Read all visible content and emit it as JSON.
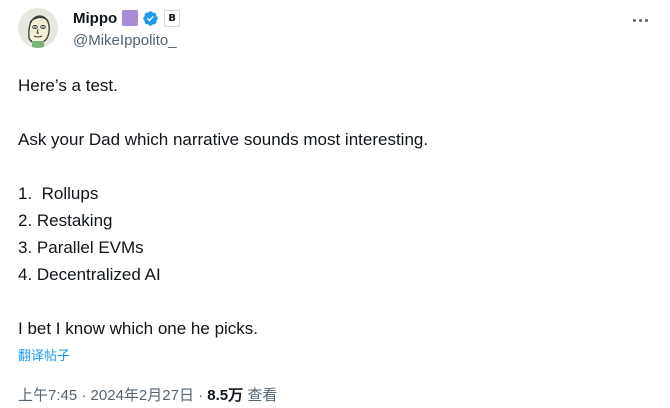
{
  "author": {
    "display_name": "Mippo",
    "handle": "@MikeIppolito_",
    "verified": true,
    "emoji_color": "#a88cd6",
    "verified_color": "#1d9bf0",
    "affiliate_badge_letter": "B"
  },
  "tweet": {
    "lines": [
      "Here’s a test.",
      "",
      "Ask your Dad which narrative sounds most interesting.",
      "",
      "1.  Rollups",
      "2. Restaking",
      "3. Parallel EVMs",
      "4. Decentralized AI",
      "",
      "I bet I know which one he picks."
    ],
    "translate_label": "翻译帖子"
  },
  "meta": {
    "time": "上午7:45",
    "separator": "·",
    "date": "2024年2月27日",
    "views_count": "8.5万",
    "views_label": "查看"
  },
  "icons": {
    "more": "more-icon",
    "verified": "verified-badge-icon",
    "avatar": "avatar"
  }
}
